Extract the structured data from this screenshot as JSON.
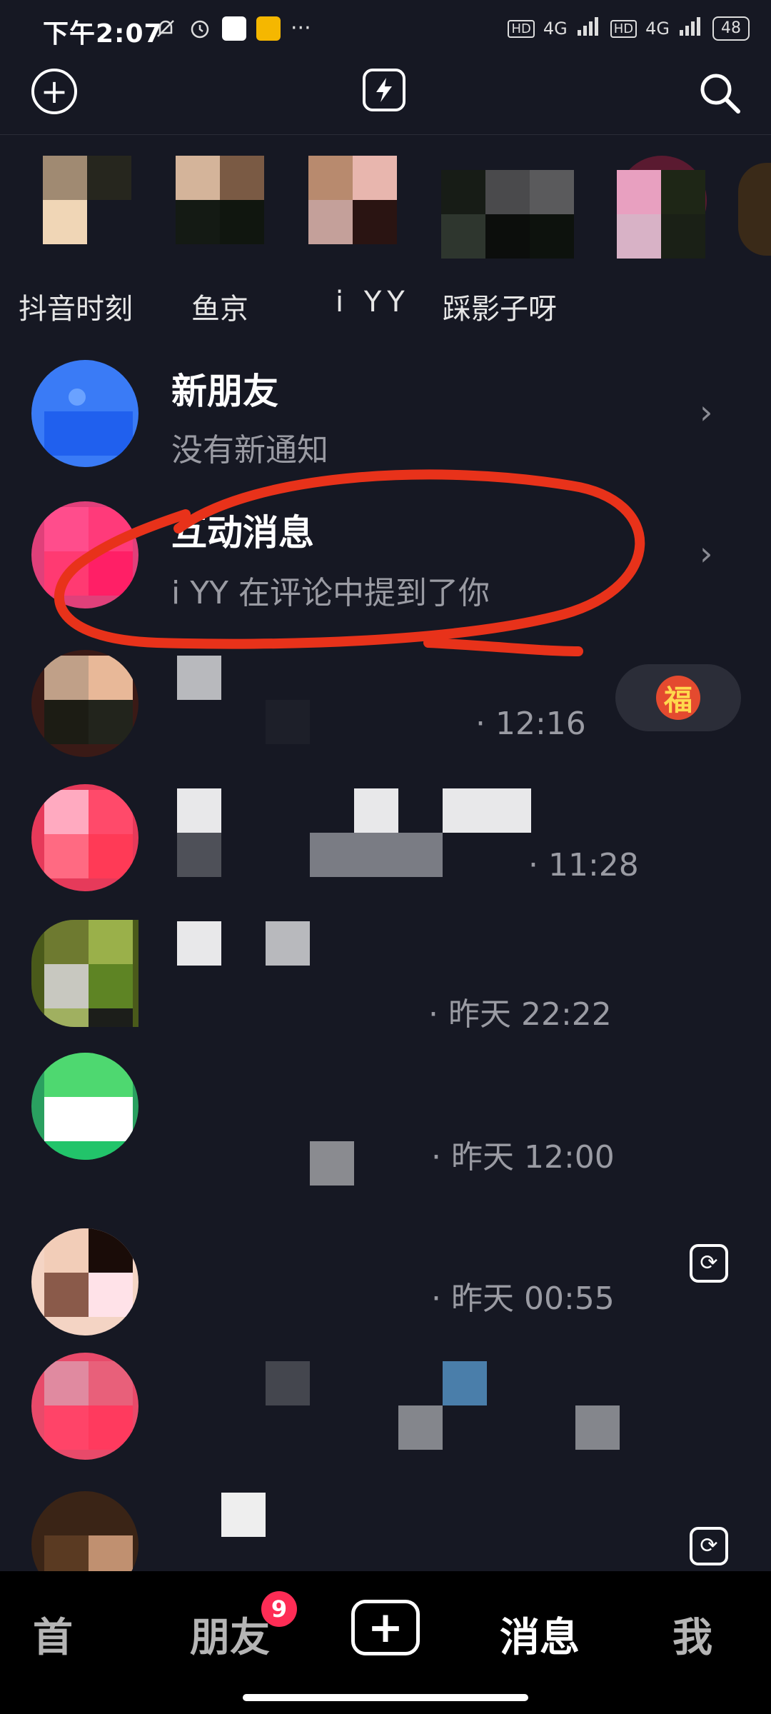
{
  "status_bar": {
    "time": "下午2:07",
    "more": "···",
    "hd1": "HD",
    "net1": "4G",
    "hd2": "HD",
    "net2": "4G",
    "battery": "48"
  },
  "stories": [
    {
      "label": "抖音时刻"
    },
    {
      "label": "鱼京"
    },
    {
      "label": "i YY"
    },
    {
      "label": "踩影子呀"
    }
  ],
  "rows": {
    "new_friends": {
      "title": "新朋友",
      "subtitle": "没有新通知"
    },
    "interactions": {
      "title": "互动消息",
      "subtitle": "i YY 在评论中提到了你"
    },
    "times": [
      "· 12:16",
      "· 11:28",
      "· 昨天 22:22",
      "· 昨天 12:00",
      "· 昨天 00:55"
    ]
  },
  "fu_glyph": "福",
  "nav": {
    "home": "首",
    "friends": "朋友",
    "friends_badge": "9",
    "add": "+",
    "messages": "消息",
    "me": "我"
  },
  "colors": {
    "background": "#161823",
    "accent_badge": "#fe2c55",
    "annotation_red": "#e8321a"
  }
}
